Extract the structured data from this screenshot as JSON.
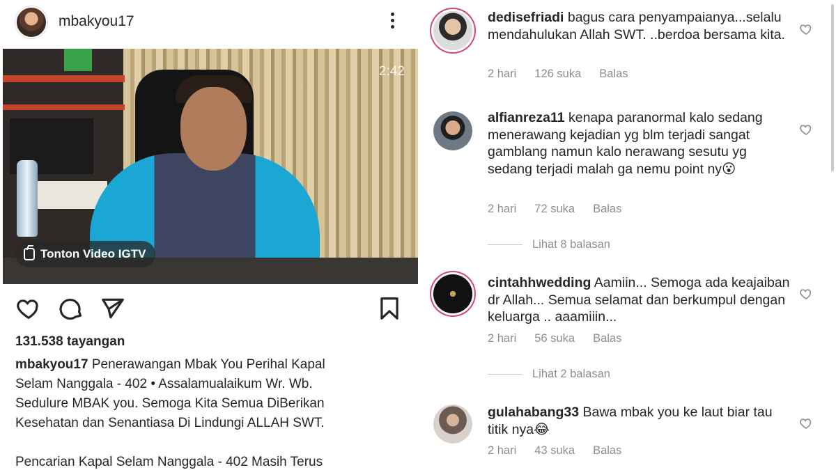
{
  "post": {
    "username": "mbakyou17",
    "duration": "2:42",
    "igtv_label": "Tonton Video IGTV",
    "views": "131.538 tayangan",
    "caption_user": "mbakyou17",
    "caption_lines": [
      " Penerawangan Mbak You Perihal Kapal",
      "Selam Nanggala - 402 • Assalamualaikum Wr. Wb.",
      "Sedulure MBAK you.  Semoga Kita Semua DiBerikan",
      "Kesehatan dan Senantiasa Di Lindungi ALLAH SWT."
    ],
    "caption_after": "Pencarian Kapal Selam Nanggala - 402 Masih Terus",
    "icons": [
      "more-icon",
      "heart-icon",
      "comment-icon",
      "share-icon",
      "bookmark-icon",
      "igtv-icon"
    ]
  },
  "comments": [
    {
      "username": "dedisefriadi",
      "text": " bagus cara penyampaianya...selalu mendahulukan Allah SWT. ..berdoa bersama kita.",
      "time": "2 hari",
      "likes": "126 suka",
      "reply": "Balas"
    },
    {
      "username": "alfianreza11",
      "text": " kenapa paranormal kalo sedang menerawang kejadian yg blm terjadi sangat gamblang namun kalo nerawang sesutu yg sedang terjadi malah ga nemu point ny😮",
      "time": "2 hari",
      "likes": "72 suka",
      "reply": "Balas",
      "view_replies": "Lihat 8 balasan"
    },
    {
      "username": "cintahhwedding",
      "text": " Aamiin... Semoga ada keajaiban dr Allah... Semua selamat dan berkumpul dengan keluarga .. aaamiiin...",
      "time": "2 hari",
      "likes": "56 suka",
      "reply": "Balas",
      "view_replies": "Lihat 2 balasan"
    },
    {
      "username": "gulahabang33",
      "text": " Bawa mbak you ke laut biar tau titik nya😂",
      "time": "2 hari",
      "likes": "43 suka",
      "reply": "Balas"
    }
  ],
  "colors": {
    "text": "#262626",
    "muted": "#8e8e8e",
    "story_ring": "#d44a6a"
  }
}
